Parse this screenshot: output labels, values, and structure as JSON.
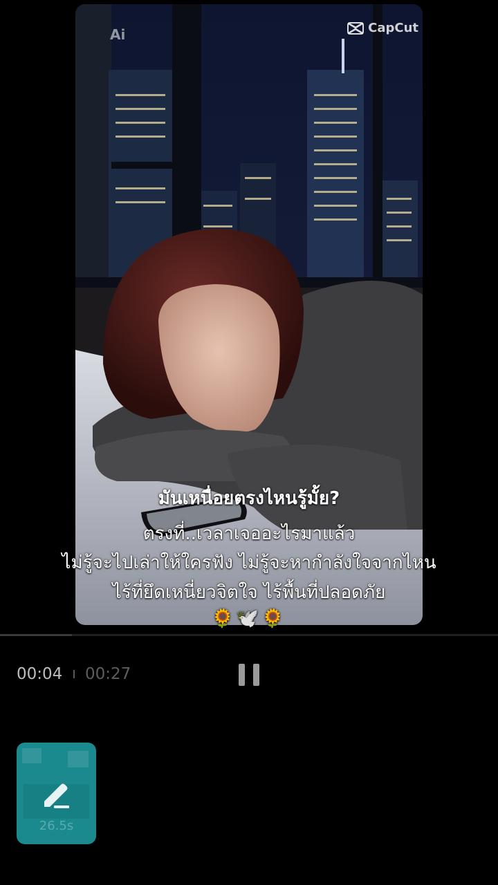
{
  "video": {
    "watermark": "CapCut",
    "ai_mark": "Ai",
    "captions": {
      "title": "มันเหนื่อยตรงไหนรู้มั้ย?",
      "line1": "ตรงที่..เวลาเจออะไรมาแล้ว",
      "line2": "ไม่รู้จะไปเล่าให้ใครฟัง ไม่รู้จะหากำลังใจจากไหน",
      "line3": "ไร้ที่ยึดเหนี่ยวจิตใจ ไร้พื้นที่ปลอดภัย",
      "emoji": "🌻🕊️🌻"
    }
  },
  "player": {
    "current_time": "00:04",
    "total_time": "00:27",
    "progress_fraction": 0.145,
    "state": "playing",
    "pause_icon": "pause-icon"
  },
  "edit_thumbnail": {
    "duration": "26.5s",
    "icon": "pencil-icon",
    "color": "#1a8a8f"
  }
}
